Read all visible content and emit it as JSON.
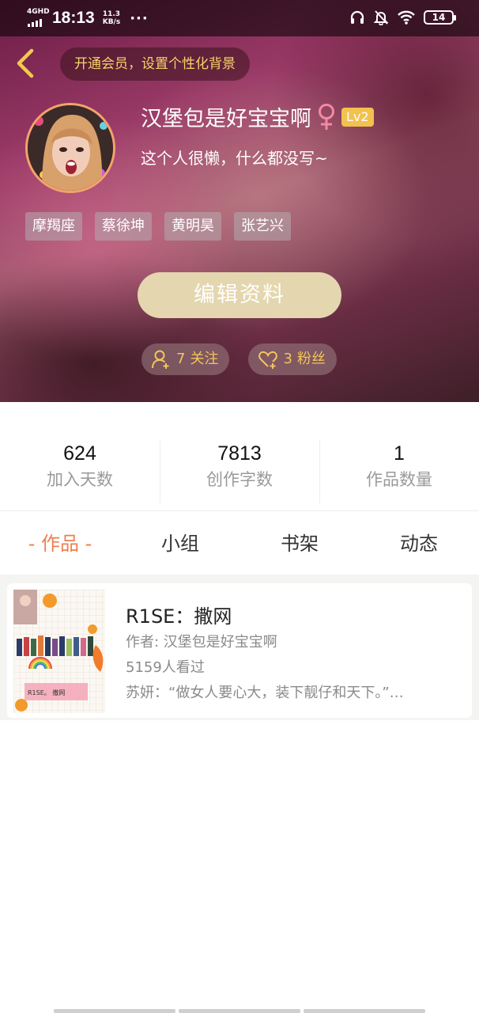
{
  "status_bar": {
    "network": "4GHD",
    "time": "18:13",
    "speed_value": "11.3",
    "speed_unit": "KB/s",
    "more": "···",
    "battery": "14"
  },
  "header": {
    "vip_prompt": "开通会员，设置个性化背景",
    "nickname": "汉堡包是好宝宝啊",
    "gender": "female",
    "level": "Lv2",
    "signature": "这个人很懒，什么都没写~",
    "tags": [
      "摩羯座",
      "蔡徐坤",
      "黄明昊",
      "张艺兴"
    ],
    "edit_button": "编辑资料",
    "following_count": "7",
    "following_label": "关注",
    "fans_count": "3",
    "fans_label": "粉丝"
  },
  "stats": [
    {
      "value": "624",
      "label": "加入天数"
    },
    {
      "value": "7813",
      "label": "创作字数"
    },
    {
      "value": "1",
      "label": "作品数量"
    }
  ],
  "tabs": [
    {
      "label": "- 作品 -",
      "active": true
    },
    {
      "label": "小组",
      "active": false
    },
    {
      "label": "书架",
      "active": false
    },
    {
      "label": "动态",
      "active": false
    }
  ],
  "works": [
    {
      "title": "R1SE：撒网",
      "author": "作者: 汉堡包是好宝宝啊",
      "views": "5159人看过",
      "excerpt": "苏妍：“做女人要心大，装下靓仔和天下。”…",
      "cover_text": "R1SE。 撒网"
    }
  ],
  "colors": {
    "accent": "#ee7f4f",
    "gold": "#f3c45b",
    "edit_button_bg": "#e4d6ae",
    "level_badge": "#f2c14e",
    "gender_icon": "#f28aa3"
  }
}
